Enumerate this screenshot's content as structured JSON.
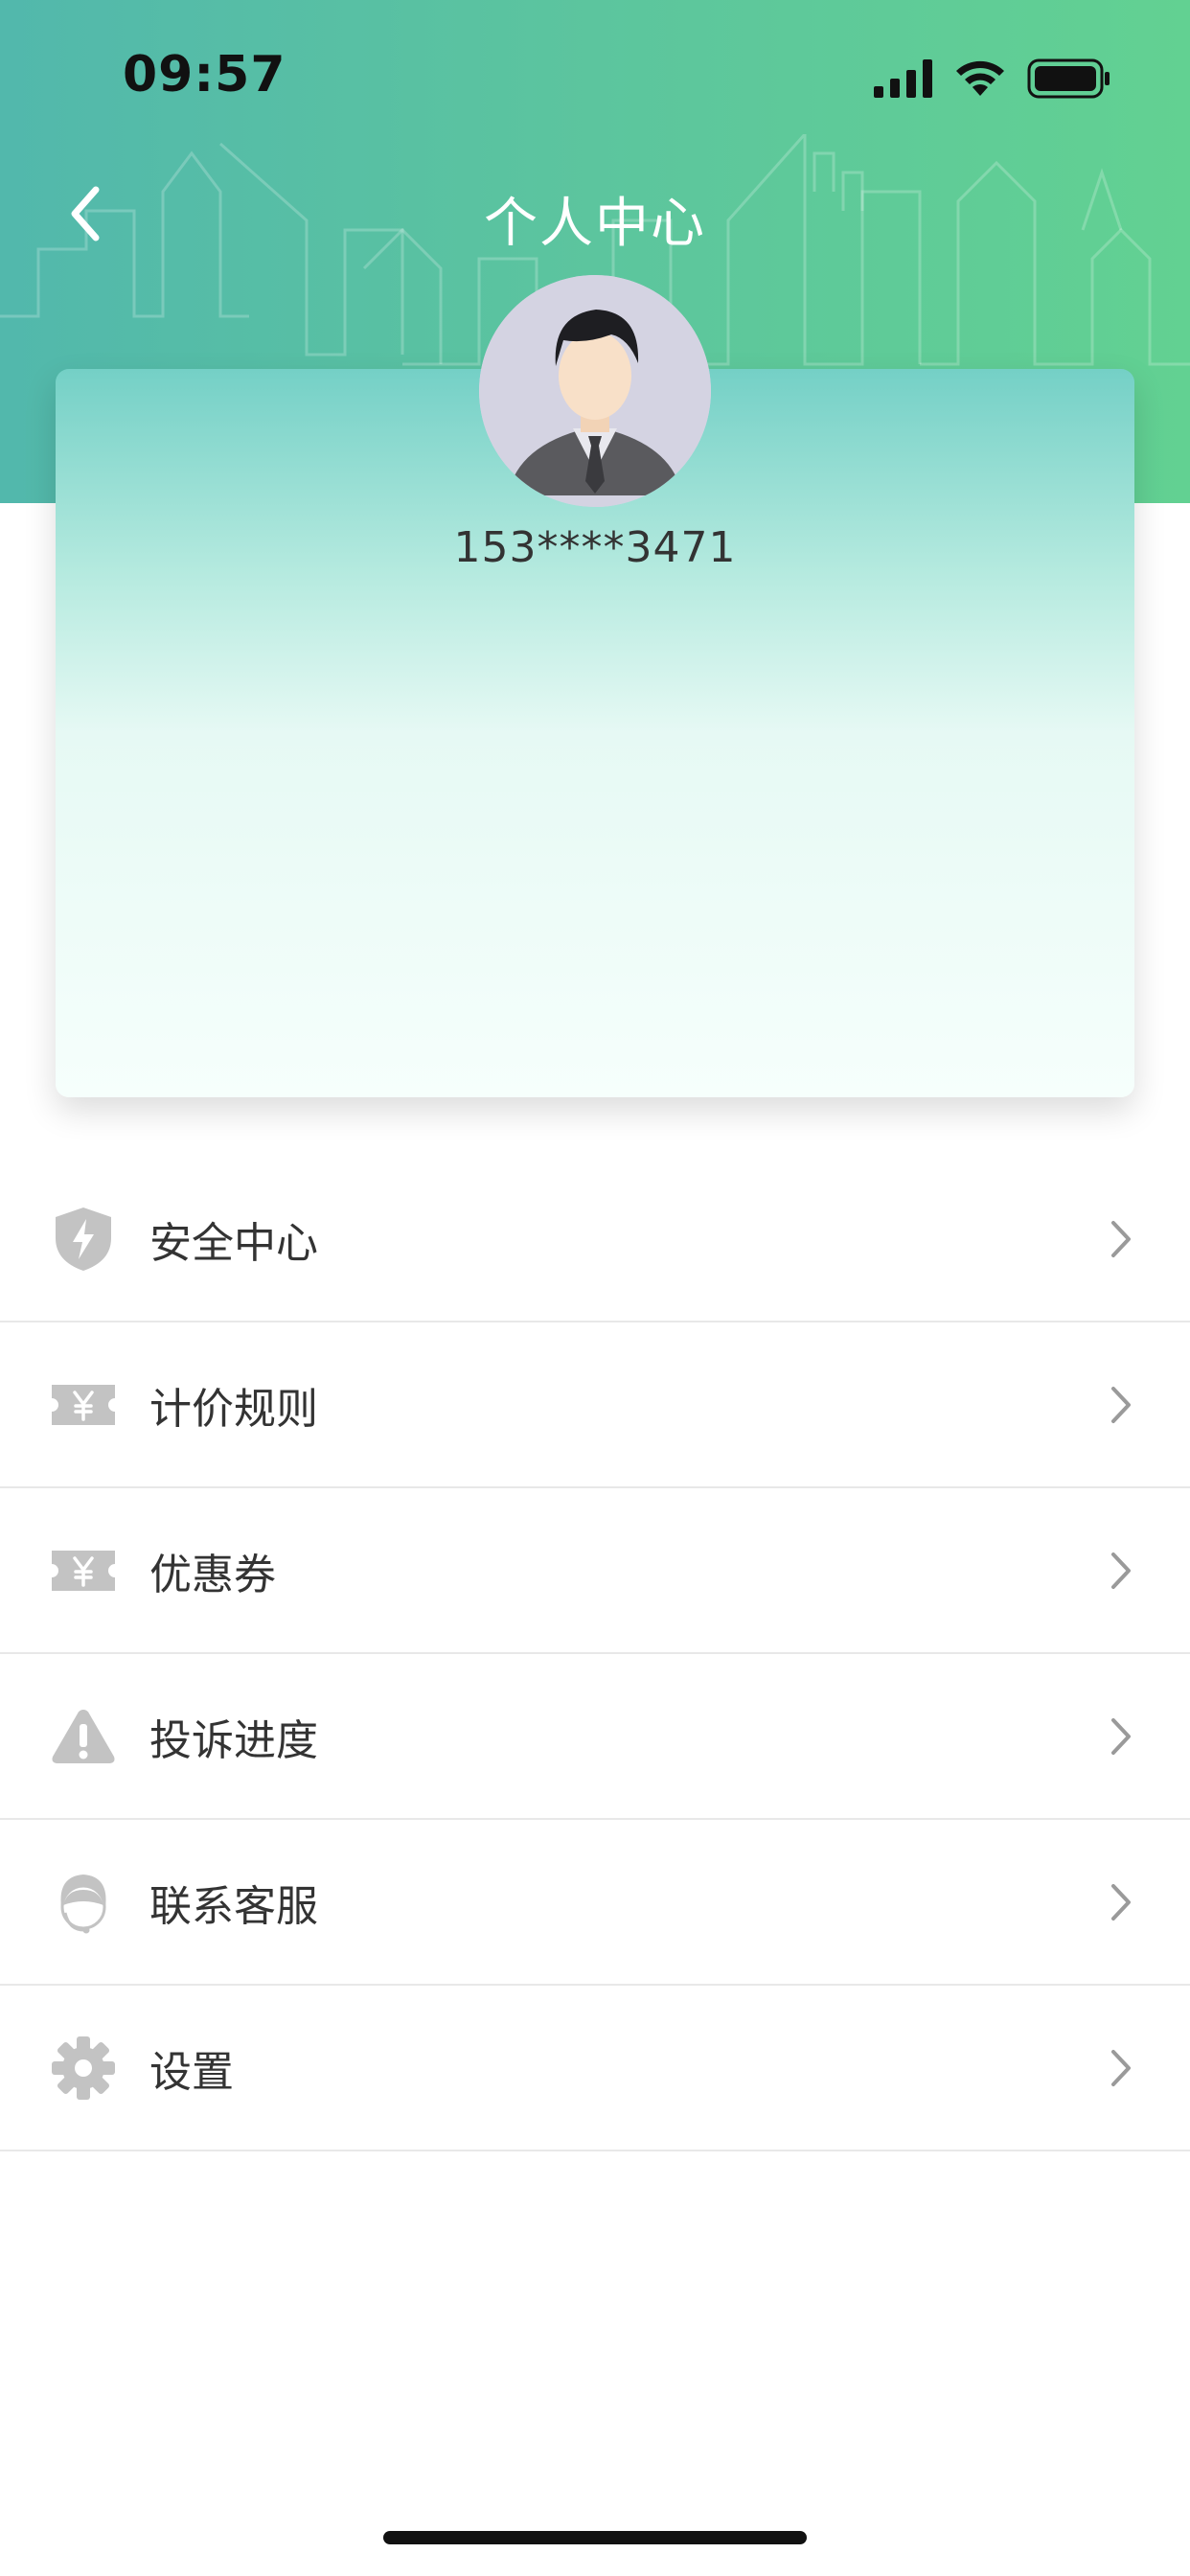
{
  "status_bar": {
    "time": "09:57"
  },
  "header": {
    "title": "个人中心"
  },
  "profile": {
    "phone": "153****3471"
  },
  "menu": [
    {
      "label": "安全中心",
      "icon": "shield-bolt-icon"
    },
    {
      "label": "计价规则",
      "icon": "ticket-yen-icon"
    },
    {
      "label": "优惠券",
      "icon": "ticket-yen-icon"
    },
    {
      "label": "投诉进度",
      "icon": "warning-icon"
    },
    {
      "label": "联系客服",
      "icon": "customer-service-icon"
    },
    {
      "label": "设置",
      "icon": "gear-icon"
    }
  ],
  "colors": {
    "header_start": "#52b8ac",
    "header_end": "#62d192",
    "icon_gray": "#c3c3c3",
    "text": "#333333"
  }
}
